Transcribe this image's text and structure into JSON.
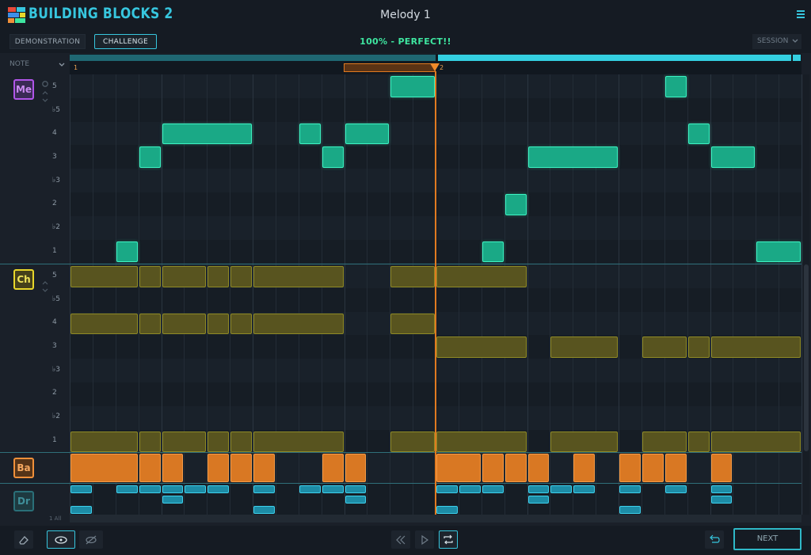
{
  "header": {
    "app_title": "BUILDING BLOCKS 2",
    "doc_title": "Melody 1",
    "menu_icon": "hamburger-icon"
  },
  "toolbar": {
    "demonstration_label": "DEMONSTRATION",
    "challenge_label": "CHALLENGE",
    "score_text": "100% - PERFECT!!",
    "session_label": "SESSION"
  },
  "timeline": {
    "note_label": "NOTE",
    "bar_1": "1",
    "bar_2": "2"
  },
  "tracks": {
    "melody": {
      "label": "Me",
      "color": "#b055e8",
      "note_labels": [
        "5",
        "♭5",
        "4",
        "3",
        "♭3",
        "2",
        "♭2",
        "1"
      ]
    },
    "chords": {
      "label": "Ch",
      "color": "#e8d62a",
      "note_labels": [
        "5",
        "♭5",
        "4",
        "3",
        "♭3",
        "2",
        "♭2",
        "1"
      ]
    },
    "bass": {
      "label": "Ba",
      "color": "#f0903a"
    },
    "drums": {
      "label": "Dr",
      "color": "#2aa4b4"
    }
  },
  "bottom": {
    "scroll_label": "1 All"
  },
  "footer": {
    "next_label": "NEXT",
    "icons": [
      "eraser-icon",
      "view-icon",
      "hide-icon",
      "rewind-icon",
      "play-icon",
      "loop-icon",
      "undo-icon"
    ]
  },
  "colors": {
    "accent": "#37c6de",
    "melody_block": "#1aa986",
    "chord_block": "#58541f",
    "bass_block": "#d97823",
    "drum_block": "#1d8ca6",
    "playhead": "#e07a20",
    "score": "#3ee6a0"
  }
}
